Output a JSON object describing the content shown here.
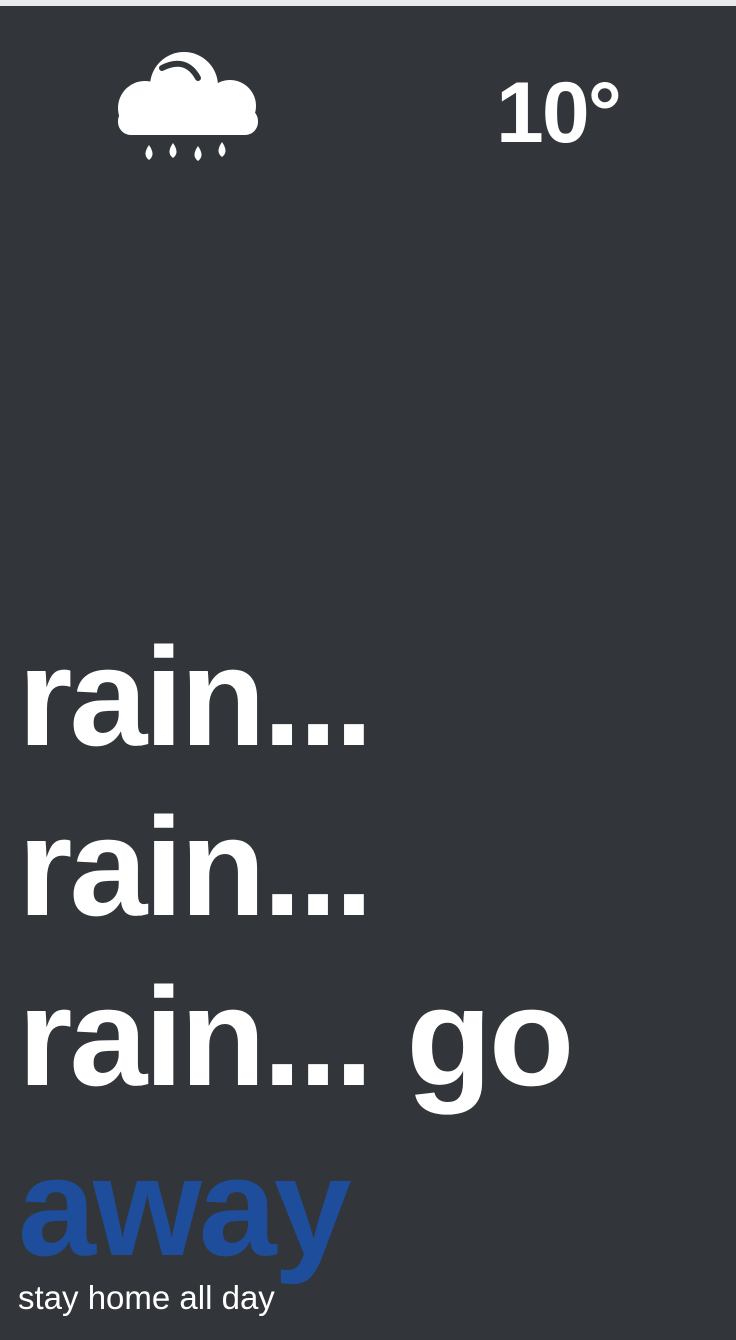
{
  "weather": {
    "icon": "cloud-rain-icon",
    "temperature": "10°"
  },
  "headline": {
    "lines": [
      "rain...",
      "rain...",
      "rain... go"
    ],
    "accent_word": "away",
    "accent_color": "#1e4e9b"
  },
  "subtitle": "stay home all day",
  "colors": {
    "background": "#32363a",
    "text": "#ffffff"
  }
}
